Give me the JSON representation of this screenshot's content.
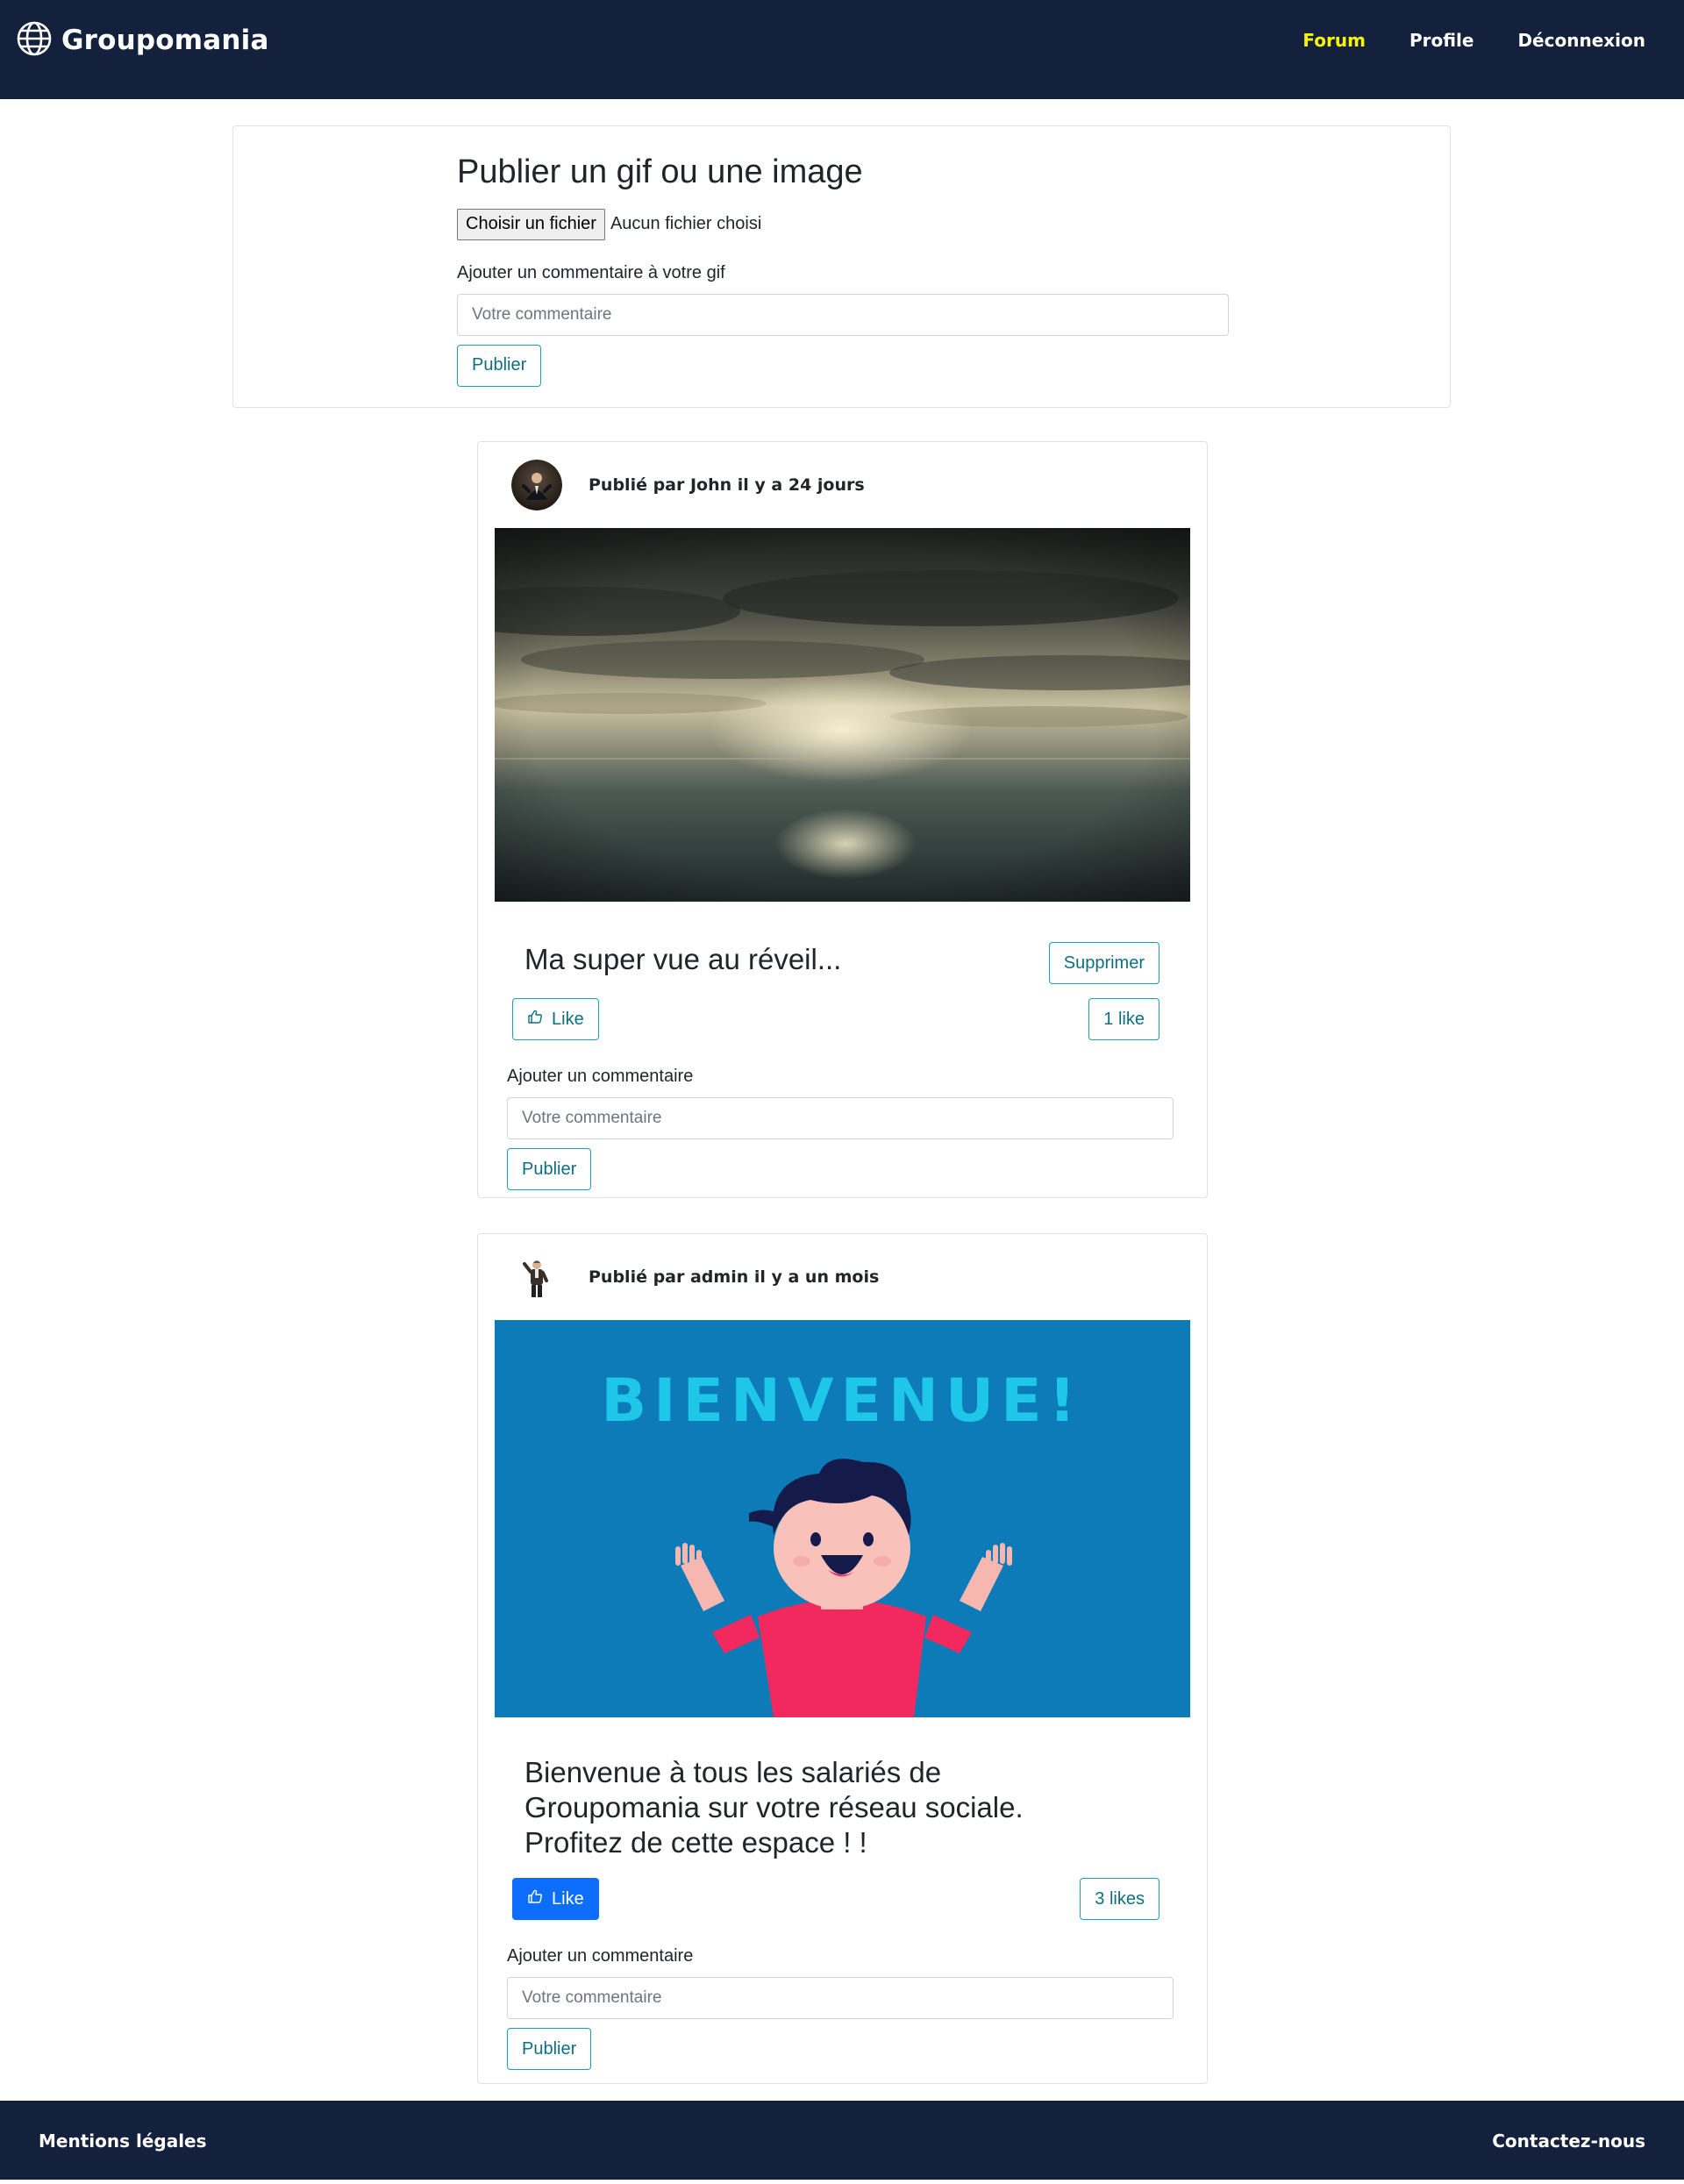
{
  "colors": {
    "navbar_bg": "#14213d",
    "active_nav": "#f7f40a",
    "outline_accent": "#17a2b8",
    "primary": "#0d6efd"
  },
  "navbar": {
    "brand": "Groupomania",
    "brand_icon": "globe-icon",
    "links": [
      {
        "label": "Forum",
        "active": true
      },
      {
        "label": "Profile",
        "active": false
      },
      {
        "label": "Déconnexion",
        "active": false
      }
    ]
  },
  "upload": {
    "title": "Publier un gif ou une image",
    "file_button": "Choisir un fichier",
    "file_status": "Aucun fichier choisi",
    "comment_label": "Ajouter un commentaire à votre gif",
    "comment_placeholder": "Votre commentaire",
    "submit_label": "Publier"
  },
  "posts": [
    {
      "author_line": "Publié par John il y a 24 jours",
      "media": "photo of clouds and sunlight over the sea",
      "caption": "Ma super vue au réveil...",
      "delete_label": "Supprimer",
      "like_label": "Like",
      "like_icon": "thumbs-up-icon",
      "liked": false,
      "likes_count": "1 like",
      "comment_label": "Ajouter un commentaire",
      "comment_placeholder": "Votre commentaire",
      "submit_label": "Publier"
    },
    {
      "author_line": "Publié par admin il y a un mois",
      "media_text": "BIENVENUE!",
      "caption": "Bienvenue à tous les salariés de Groupomania sur votre réseau sociale. Profitez de cette espace ! !",
      "like_label": "Like",
      "like_icon": "thumbs-up-icon",
      "liked": true,
      "likes_count": "3 likes",
      "comment_label": "Ajouter un commentaire",
      "comment_placeholder": "Votre commentaire",
      "submit_label": "Publier"
    }
  ],
  "footer": {
    "left_link": "Mentions légales",
    "right_link": "Contactez-nous"
  }
}
